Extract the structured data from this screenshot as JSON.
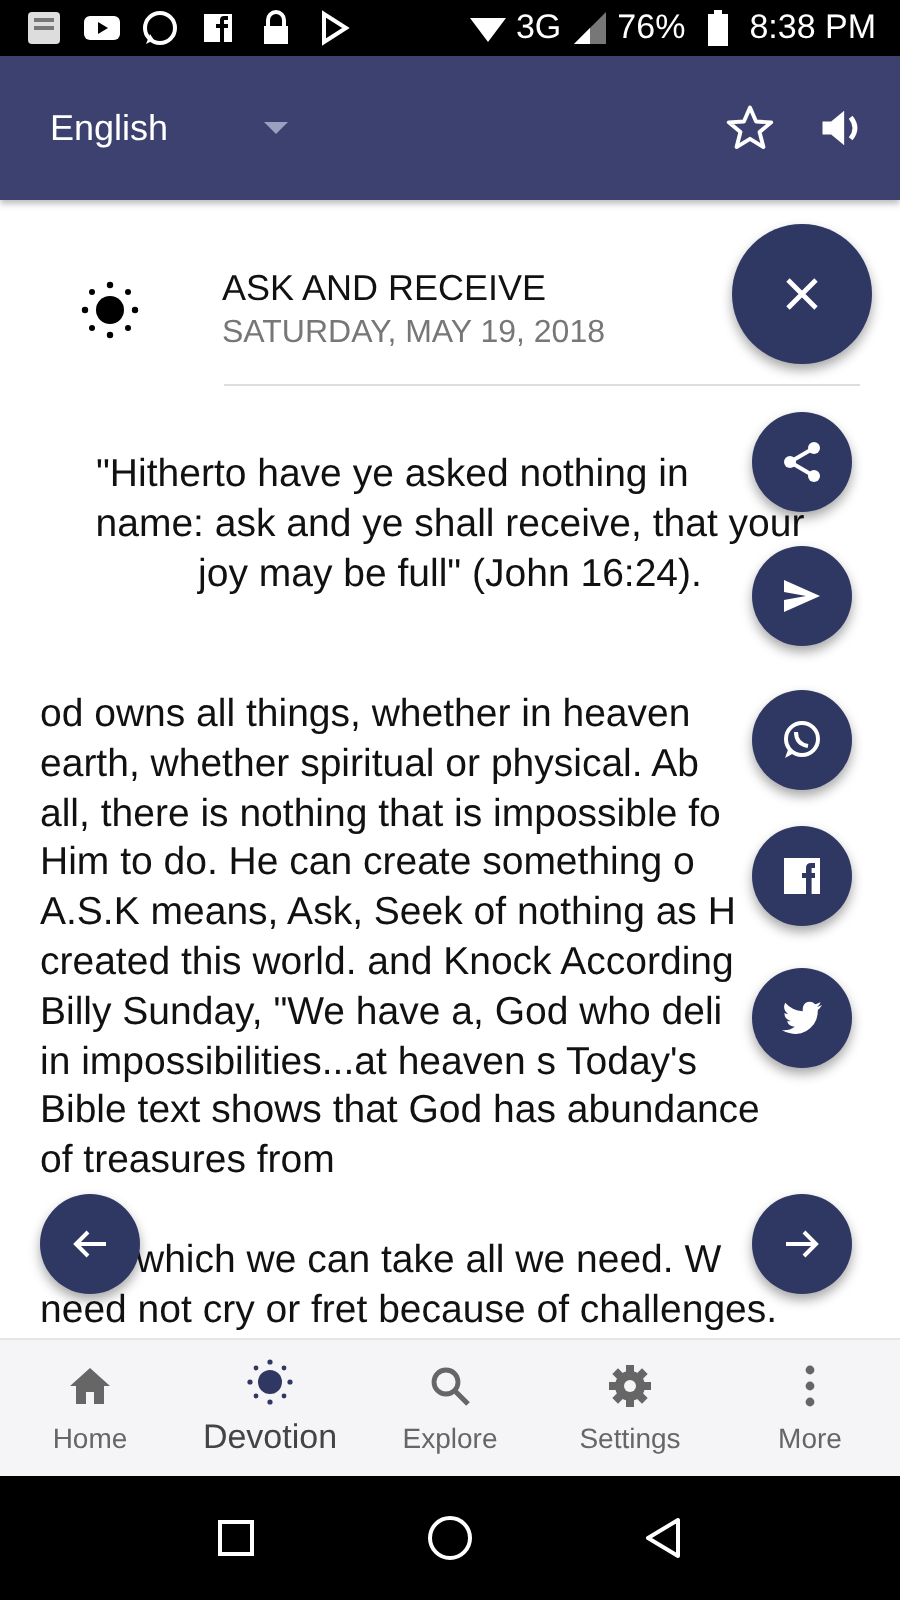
{
  "status_bar": {
    "network": "3G",
    "battery": "76%",
    "time": "8:38 PM"
  },
  "app_bar": {
    "language": "English"
  },
  "devotion": {
    "title": "ASK AND RECEIVE",
    "date": "SATURDAY, MAY 19, 2018",
    "verse_lines": [
      "\"Hitherto have ye asked nothing in",
      "name: ask and ye shall receive, that your",
      "joy may be full\" (John 16:24)."
    ],
    "paragraphs": [
      [
        "od owns all things, whether in heaven",
        "earth, whether spiritual or physical. Ab",
        "all, there is nothing that is impossible fo",
        "Him to do. He can create something o",
        "A.S.K means, Ask, Seek of nothing as H",
        "created this world. and Knock According",
        "Billy Sunday, \"We have a, God who deli",
        "in impossibilities...at heaven s Today's",
        "Bible text shows that God has abundance",
        "of treasures from"
      ],
      [
        "which we can take all we need. W",
        "need not cry or fret because of challenges."
      ]
    ]
  },
  "bottom_nav": [
    {
      "label": "Home",
      "selected": false
    },
    {
      "label": "Devotion",
      "selected": true
    },
    {
      "label": "Explore",
      "selected": false
    },
    {
      "label": "Settings",
      "selected": false
    },
    {
      "label": "More",
      "selected": false
    }
  ]
}
